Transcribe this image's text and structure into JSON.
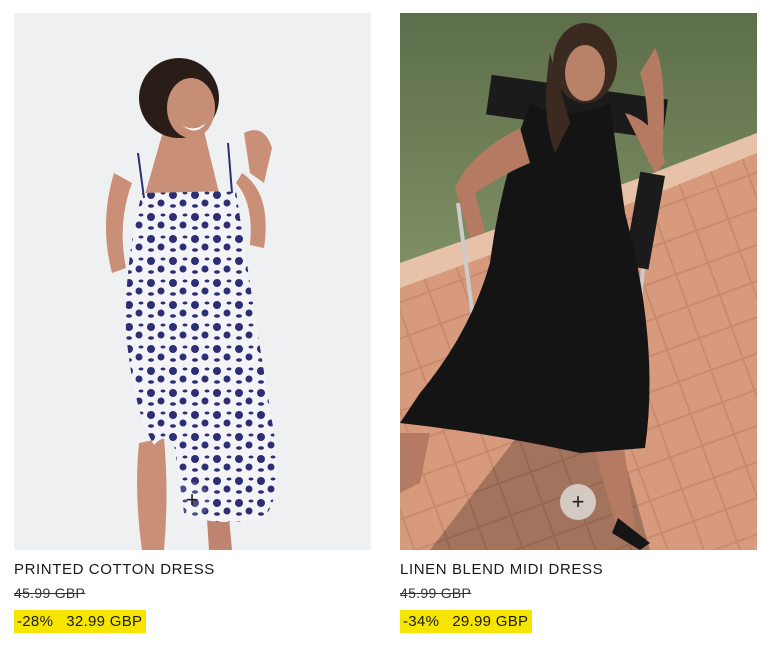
{
  "products": [
    {
      "name": "PRINTED COTTON DRESS",
      "old_price": "45.99 GBP",
      "discount": "-28%",
      "price": "32.99 GBP",
      "add_icon": "plus-icon"
    },
    {
      "name": "LINEN BLEND MIDI DRESS",
      "old_price": "45.99 GBP",
      "discount": "-34%",
      "price": "29.99 GBP",
      "add_icon": "plus-icon"
    }
  ],
  "colors": {
    "sale_highlight": "#f5e500",
    "text": "#1a1a1a"
  }
}
